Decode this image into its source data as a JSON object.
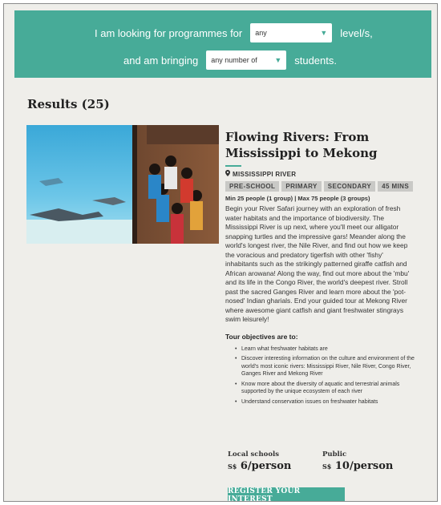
{
  "filters": {
    "prefix": "I am looking for programmes for",
    "level_value": "any",
    "level_suffix": "level/s,",
    "bring_prefix": "and am bringing",
    "count_value": "any number of",
    "count_suffix": "students."
  },
  "results": {
    "title": "Results (25)"
  },
  "programme": {
    "title": "Flowing Rivers: From Mississippi to Mekong",
    "location": "MISSISSIPPI RIVER",
    "tags": [
      "PRE-SCHOOL",
      "PRIMARY",
      "SECONDARY",
      "45 MINS"
    ],
    "capacity": "Min 25 people (1 group) | Max 75 people (3 groups)",
    "description": "Begin your River Safari journey with an exploration of fresh water habitats and the importance of biodiversity. The Mississippi River is up next, where you'll meet our alligator snapping turtles and the impressive gars! Meander along the world's longest river, the Nile River, and find out how we keep the voracious and predatory tigerfish with other 'fishy' inhabitants such as the strikingly patterned giraffe catfish and African arowana! Along the way, find out more about the 'mbu' and its life in the Congo River, the world's deepest river. Stroll past the sacred Ganges River and learn more about the 'pot-nosed' Indian gharials. End your guided tour at Mekong River where awesome giant catfish and giant freshwater stingrays swim leisurely!",
    "objectives_title": "Tour objectives are to:",
    "objectives": [
      "Learn what freshwater habitats are",
      "Discover interesting information on the culture and environment of the world's most iconic rivers: Mississippi River, Nile River, Congo River, Ganges River and Mekong River",
      "Know more about the diversity of aquatic and terrestrial animals supported by the unique ecosystem of each river",
      "Understand conservation issues on freshwater habitats"
    ],
    "price_local_label": "Local schools",
    "price_local_currency": "S$",
    "price_local_value": "6/person",
    "price_public_label": "Public",
    "price_public_currency": "S$",
    "price_public_value": "10/person",
    "register_label": "REGISTER YOUR INTEREST"
  },
  "icons": {
    "location": "map-pin-icon",
    "dropdown": "chevron-down-icon"
  },
  "colors": {
    "accent": "#47ab98",
    "background": "#efeeea",
    "tag": "#c9c9c6"
  }
}
